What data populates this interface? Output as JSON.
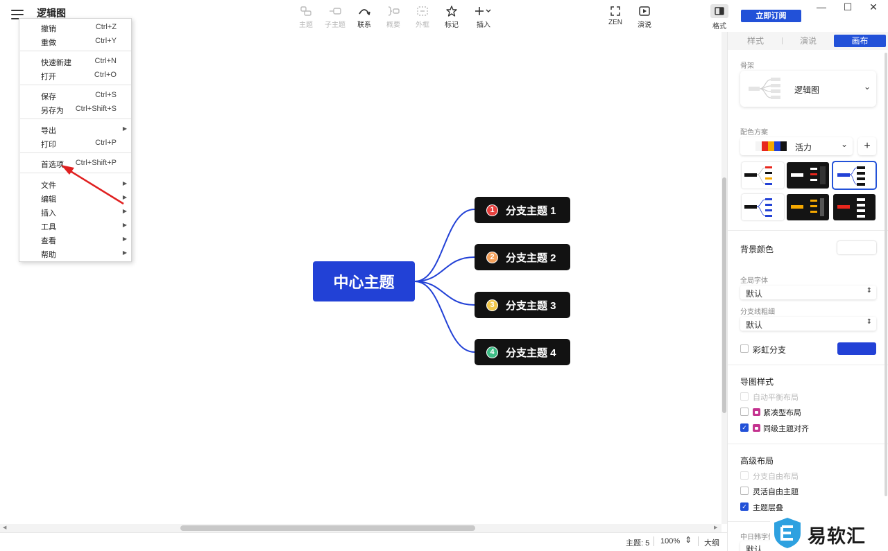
{
  "app": {
    "title": "逻辑图",
    "subscribe_label": "立即订阅",
    "window": {
      "minimize": "—",
      "maximize": "☐",
      "close": "✕"
    }
  },
  "toolbar": {
    "tools": [
      {
        "label": "主题",
        "icon": "topic-icon",
        "enabled": false
      },
      {
        "label": "子主题",
        "icon": "subtopic-icon",
        "enabled": false
      },
      {
        "label": "联系",
        "icon": "relationship-icon",
        "enabled": true
      },
      {
        "label": "概要",
        "icon": "summary-icon",
        "enabled": false
      },
      {
        "label": "外框",
        "icon": "boundary-icon",
        "enabled": false
      },
      {
        "label": "标记",
        "icon": "star-icon",
        "enabled": true
      },
      {
        "label": "插入",
        "icon": "plus-icon",
        "enabled": true
      }
    ],
    "right_tools": [
      {
        "label": "ZEN",
        "icon": "zen-icon"
      },
      {
        "label": "演说",
        "icon": "play-icon"
      }
    ],
    "format_label": "格式"
  },
  "menu": {
    "items": [
      {
        "label": "撤销",
        "shortcut": "Ctrl+Z"
      },
      {
        "label": "重做",
        "shortcut": "Ctrl+Y"
      },
      {
        "label": "快速新建",
        "shortcut": "Ctrl+N"
      },
      {
        "label": "打开",
        "shortcut": "Ctrl+O"
      },
      {
        "label": "保存",
        "shortcut": "Ctrl+S"
      },
      {
        "label": "另存为",
        "shortcut": "Ctrl+Shift+S"
      },
      {
        "label": "导出",
        "shortcut": ""
      },
      {
        "label": "打印",
        "shortcut": "Ctrl+P"
      },
      {
        "label": "首选项",
        "shortcut": "Ctrl+Shift+P"
      },
      {
        "label": "文件",
        "shortcut": ""
      },
      {
        "label": "编辑",
        "shortcut": ""
      },
      {
        "label": "插入",
        "shortcut": ""
      },
      {
        "label": "工具",
        "shortcut": ""
      },
      {
        "label": "查看",
        "shortcut": ""
      },
      {
        "label": "帮助",
        "shortcut": ""
      }
    ]
  },
  "mindmap": {
    "center": "中心主题",
    "branches": [
      {
        "num": "1",
        "label": "分支主题 1",
        "color": "#e8413f"
      },
      {
        "num": "2",
        "label": "分支主题 2",
        "color": "#f5a15b"
      },
      {
        "num": "3",
        "label": "分支主题 3",
        "color": "#f2c84b"
      },
      {
        "num": "4",
        "label": "分支主题 4",
        "color": "#3ebd86"
      }
    ],
    "line_color": "#2241d6"
  },
  "panel": {
    "tabs": [
      "样式",
      "演说",
      "画布"
    ],
    "active_tab": "画布",
    "skeleton_label": "骨架",
    "skeleton_value": "逻辑图",
    "color_scheme_label": "配色方案",
    "color_scheme_value": "活力",
    "color_scheme_swatches": [
      "#ffffff",
      "#e8261c",
      "#f5a800",
      "#2241d6",
      "#121212"
    ],
    "bg_color_label": "背景颜色",
    "global_font_label": "全局字体",
    "global_font_value": "默认",
    "branch_line_label": "分支线粗细",
    "branch_line_value": "默认",
    "rainbow_label": "彩虹分支",
    "rainbow_color": "#2241d6",
    "map_style_title": "导图样式",
    "map_style_options": [
      {
        "label": "自动平衡布局",
        "checked": false,
        "disabled": true,
        "locked": false
      },
      {
        "label": "紧凑型布局",
        "checked": false,
        "disabled": false,
        "locked": true
      },
      {
        "label": "同级主题对齐",
        "checked": true,
        "disabled": false,
        "locked": true
      }
    ],
    "advanced_title": "高级布局",
    "advanced_options": [
      {
        "label": "分支自由布局",
        "checked": false,
        "disabled": true
      },
      {
        "label": "灵活自由主题",
        "checked": false,
        "disabled": false
      },
      {
        "label": "主题层叠",
        "checked": true,
        "disabled": false
      }
    ],
    "cjk_font_label": "中日韩字体",
    "cjk_font_value": "默认"
  },
  "status": {
    "topics": "主题: 5",
    "zoom": "100%",
    "outline": "大纲"
  },
  "watermark": {
    "text": "易软汇"
  }
}
